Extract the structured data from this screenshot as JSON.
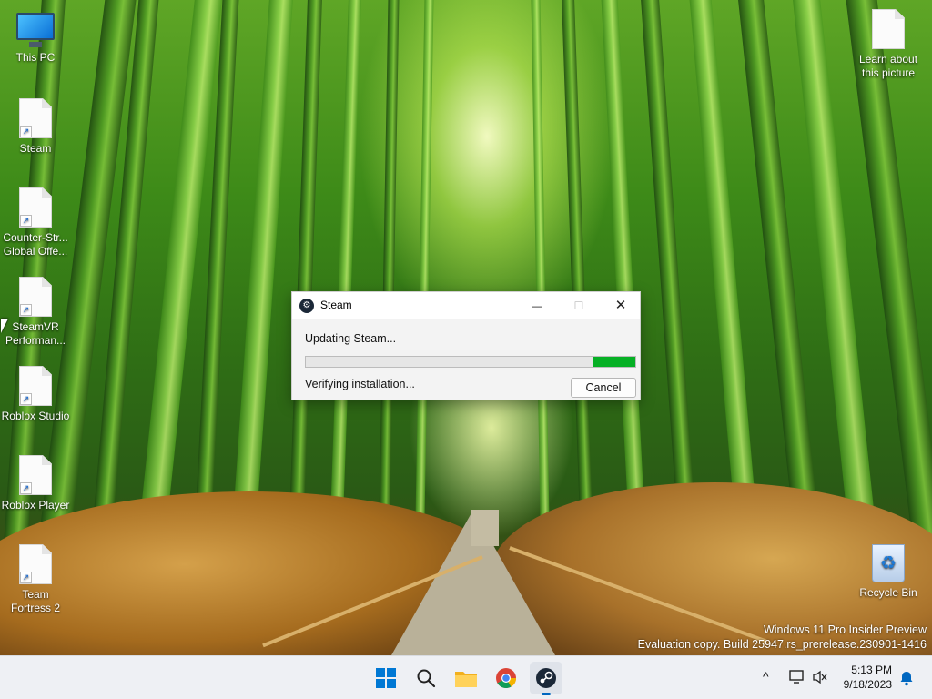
{
  "desktop": {
    "icons_left": [
      {
        "label": "This PC",
        "icon": "monitor-icon"
      },
      {
        "label": "Steam",
        "icon": "file-shortcut-icon"
      },
      {
        "label": "Counter-Str... Global Offe...",
        "icon": "file-shortcut-icon"
      },
      {
        "label": "SteamVR Performan...",
        "icon": "file-shortcut-icon"
      },
      {
        "label": "Roblox Studio",
        "icon": "file-shortcut-icon"
      },
      {
        "label": "Roblox Player",
        "icon": "file-shortcut-icon"
      },
      {
        "label": "Team Fortress 2",
        "icon": "file-shortcut-icon"
      }
    ],
    "icons_right": [
      {
        "label": "Learn about this picture",
        "icon": "file-icon"
      },
      {
        "label": "Recycle Bin",
        "icon": "recycle-bin-icon"
      }
    ],
    "watermark": {
      "line1": "Windows 11 Pro Insider Preview",
      "line2": "Evaluation copy. Build 25947.rs_prerelease.230901-1416"
    }
  },
  "dialog": {
    "title": "Steam",
    "minimize": "—",
    "maximize": "☐",
    "close": "✕",
    "status": "Updating Steam...",
    "progress_fraction": 0.13,
    "substatus": "Verifying installation...",
    "cancel_label": "Cancel"
  },
  "taskbar": {
    "apps": [
      "start-icon",
      "search-icon",
      "file-explorer-icon",
      "chrome-icon",
      "steam-icon"
    ],
    "tray": {
      "chevron": "^",
      "time": "5:13 PM",
      "date": "9/18/2023"
    }
  },
  "colors": {
    "progress_fill": "#06b025",
    "taskbar_bg": "#eef0f4",
    "accent": "#0067c0"
  }
}
